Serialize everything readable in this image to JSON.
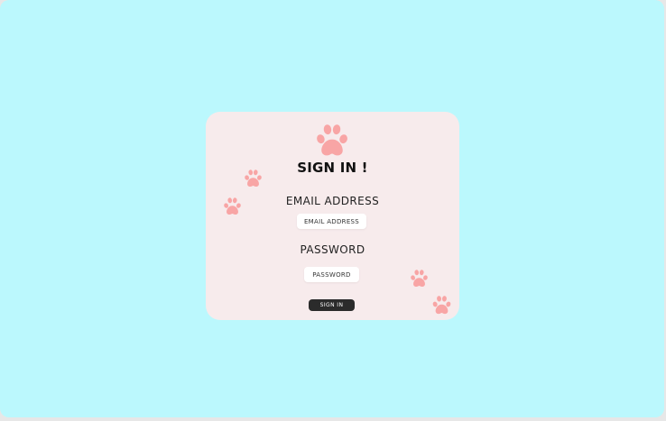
{
  "colors": {
    "background": "#bbf8fd",
    "card": "#f7ebec",
    "paw": "#f8a5a5",
    "button": "#2b2b2b",
    "field": "#ffffff"
  },
  "icons": {
    "header": "paw-icon",
    "decorations": [
      "paw-icon",
      "paw-icon",
      "paw-icon",
      "paw-icon"
    ]
  },
  "form": {
    "title": "Sign In !",
    "email": {
      "label": "Email Address",
      "placeholder": "Email Address",
      "value": ""
    },
    "password": {
      "label": "Password",
      "placeholder": "Password",
      "value": ""
    },
    "submit_label": "Sign In"
  }
}
